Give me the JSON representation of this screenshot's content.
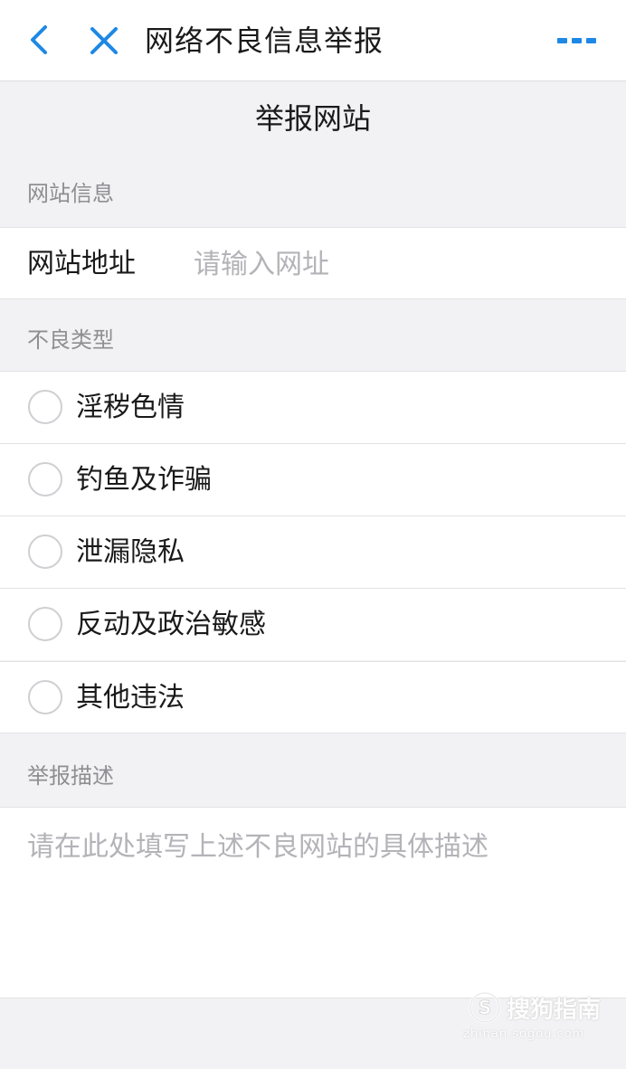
{
  "navbar": {
    "title": "网络不良信息举报",
    "back_icon": "chevron-left-icon",
    "close_icon": "close-icon",
    "more_icon": "more-dots-icon",
    "accent_color": "#1e88e5"
  },
  "page": {
    "heading": "举报网站"
  },
  "site_info": {
    "section_label": "网站信息",
    "url_label": "网站地址",
    "url_value": "",
    "url_placeholder": "请输入网址"
  },
  "bad_type": {
    "section_label": "不良类型",
    "options": [
      {
        "label": "淫秽色情",
        "selected": false
      },
      {
        "label": "钓鱼及诈骗",
        "selected": false
      },
      {
        "label": "泄漏隐私",
        "selected": false
      },
      {
        "label": "反动及政治敏感",
        "selected": false
      },
      {
        "label": "其他违法",
        "selected": false
      }
    ]
  },
  "description": {
    "section_label": "举报描述",
    "value": "",
    "placeholder": "请在此处填写上述不良网站的具体描述"
  },
  "watermark": {
    "text": "搜狗指南",
    "subtext": "zhinan.sogou.com"
  }
}
